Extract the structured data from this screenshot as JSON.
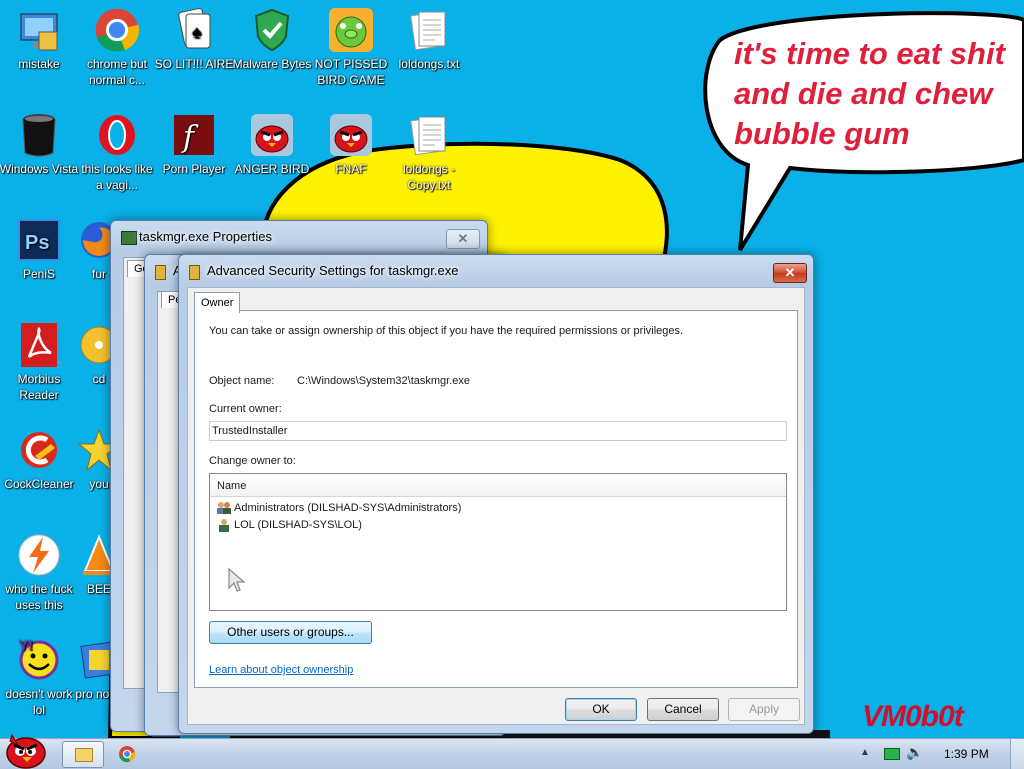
{
  "desktop": {
    "icons": [
      {
        "label": "mistake",
        "icon": "computer-icon"
      },
      {
        "label": "chrome but normal c...",
        "icon": "chrome-icon"
      },
      {
        "label": "SO LIT!!! AIRE",
        "icon": "solitaire-icon"
      },
      {
        "label": "Malware Bytes",
        "icon": "shield-icon"
      },
      {
        "label": "NOT PISSED BIRD GAME",
        "icon": "pig-icon"
      },
      {
        "label": "loldongs.txt",
        "icon": "text-file-icon"
      },
      {
        "label": "Windows Vista",
        "icon": "trash-bin-icon"
      },
      {
        "label": "this looks like a vagi...",
        "icon": "opera-icon"
      },
      {
        "label": "Porn Player",
        "icon": "flash-icon"
      },
      {
        "label": "ANGER BIRD",
        "icon": "angry-bird-icon"
      },
      {
        "label": "FNAF",
        "icon": "angry-bird-icon"
      },
      {
        "label": "loldongs - Copy.txt",
        "icon": "text-file-icon"
      },
      {
        "label": "PeniS",
        "icon": "photoshop-icon"
      },
      {
        "label": "fur",
        "icon": "firefox-icon"
      },
      {
        "label": "Morbius Reader",
        "icon": "pdf-icon"
      },
      {
        "label": "cd",
        "icon": "disc-icon"
      },
      {
        "label": "CockCleaner",
        "icon": "ccleaner-icon"
      },
      {
        "label": "you",
        "icon": "star-icon"
      },
      {
        "label": "who the fuck uses this",
        "icon": "lightning-icon"
      },
      {
        "label": "BEE",
        "icon": "vlc-icon"
      },
      {
        "label": "doesn't work lol",
        "icon": "yahoo-icon"
      },
      {
        "label": "pro not a",
        "icon": "program-icon"
      }
    ],
    "speech_bubble": "it's time to eat shit and die and chew bubble gum",
    "watermark": "VM0b0t"
  },
  "back_window": {
    "title": "taskmgr.exe Properties",
    "tab_fragment": "Ge"
  },
  "middle_window": {
    "title_fragment": "A",
    "tab_fragment": "Pe"
  },
  "dialog": {
    "title": "Advanced Security Settings for taskmgr.exe",
    "tab": "Owner",
    "intro": "You can take or assign ownership of this object if you have the required permissions or privileges.",
    "object_name_label": "Object name:",
    "object_name_value": "C:\\Windows\\System32\\taskmgr.exe",
    "current_owner_label": "Current owner:",
    "current_owner_value": "TrustedInstaller",
    "change_owner_label": "Change owner to:",
    "list_header": "Name",
    "list_items": [
      {
        "label": "Administrators (DILSHAD-SYS\\Administrators)",
        "icon": "group-users-icon"
      },
      {
        "label": "LOL (DILSHAD-SYS\\LOL)",
        "icon": "user-icon"
      }
    ],
    "other_users_button": "Other users or groups...",
    "learn_link": "Learn about object ownership",
    "ok": "OK",
    "cancel": "Cancel",
    "apply": "Apply"
  },
  "taskbar": {
    "clock": "1:39 PM"
  },
  "colors": {
    "wallpaper": "#0ab0e8",
    "blob": "#fff200",
    "bubble_text": "#e01f3d"
  }
}
